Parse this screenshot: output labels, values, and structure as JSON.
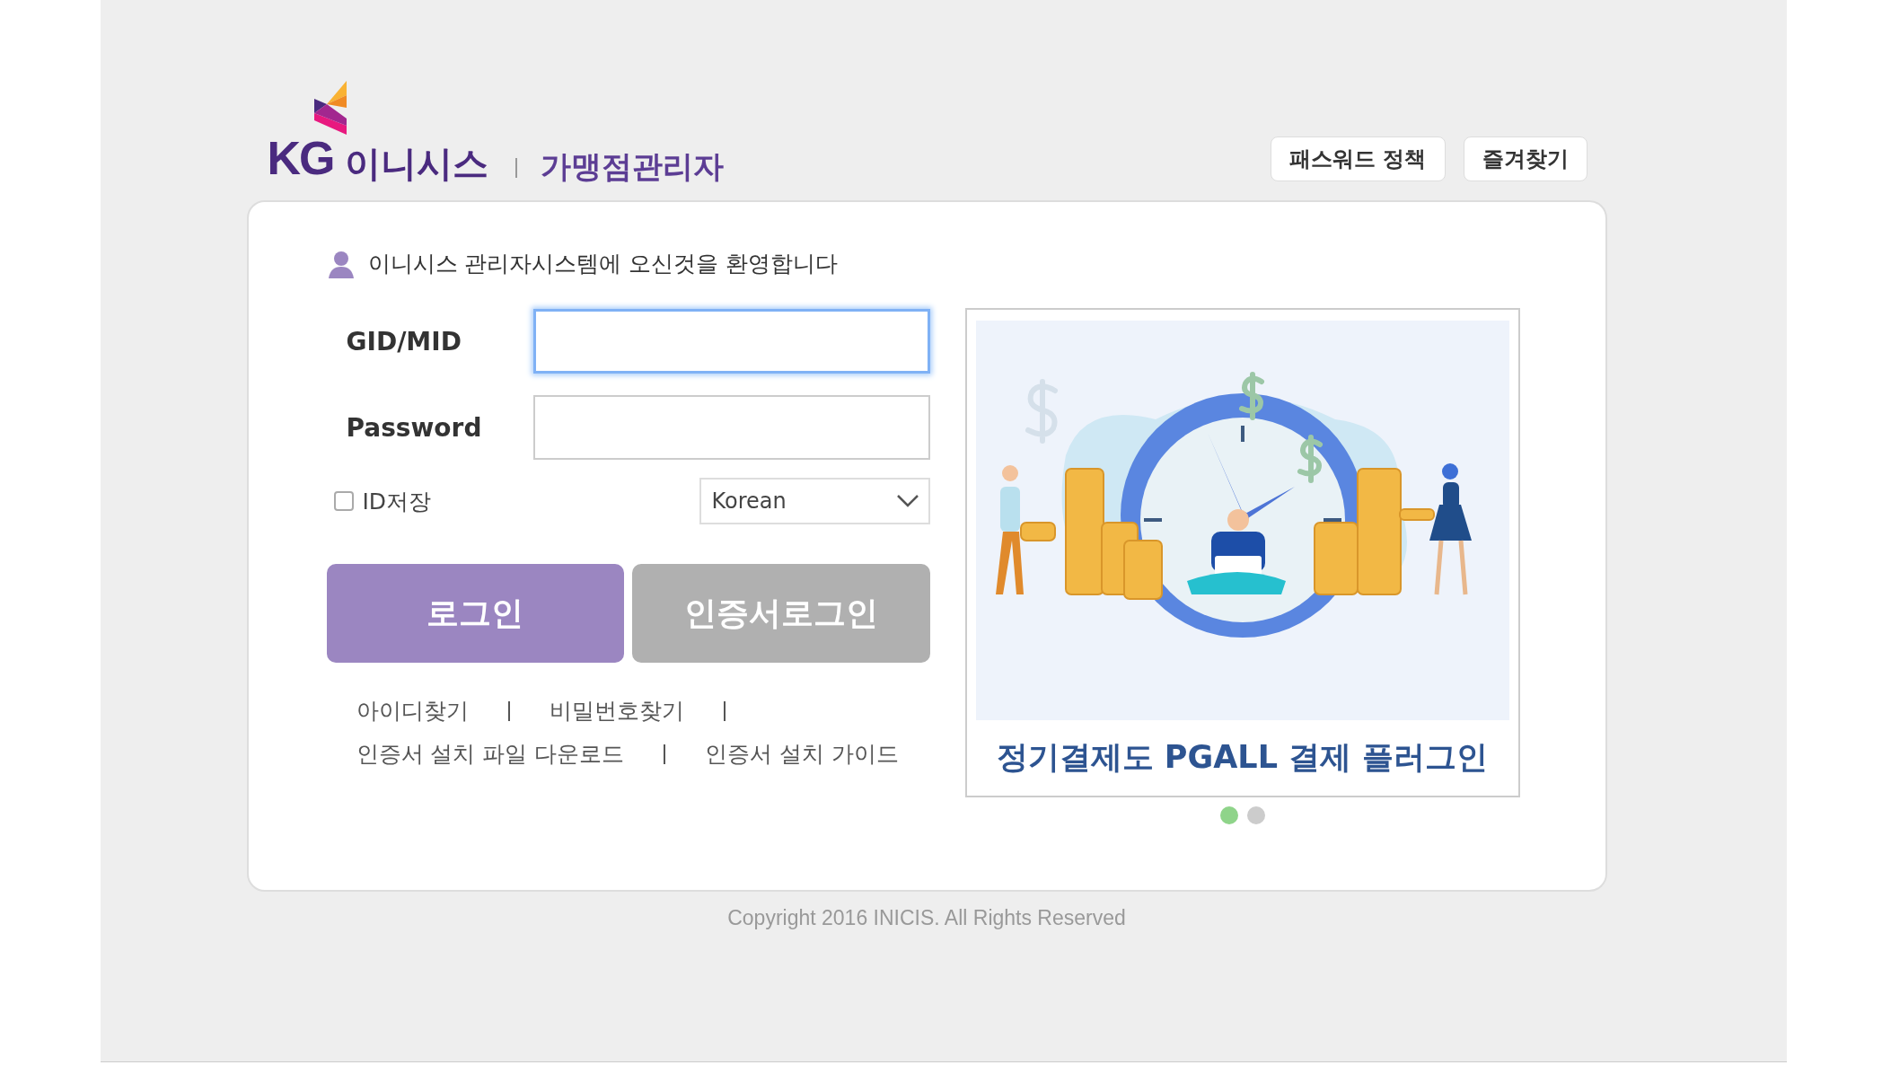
{
  "header": {
    "logo_brand": "KG",
    "logo_name": "이니시스",
    "subtitle": "가맹점관리자",
    "buttons": [
      "패스워드 정책",
      "즐겨찾기"
    ]
  },
  "welcome": "이니시스 관리자시스템에 오신것을 환영합니다",
  "fields": [
    {
      "label": "GID/MID",
      "focused": true
    },
    {
      "label": "Password",
      "focused": false
    }
  ],
  "remember": {
    "label": "ID저장",
    "checked": false
  },
  "language": {
    "value": "Korean"
  },
  "buttons": [
    {
      "label": "로그인",
      "kind": "primary"
    },
    {
      "label": "인증서로그인",
      "kind": "secondary"
    }
  ],
  "links": [
    [
      "아이디찾기",
      "비밀번호찾기"
    ],
    [
      "인증서 설치 파일 다운로드",
      "인증서 설치 가이드"
    ]
  ],
  "banner": {
    "caption": "정기결제도 PGALL 결제 플러그인",
    "dots": [
      {
        "selected": true
      },
      {
        "selected": false
      }
    ]
  },
  "copyright": "Copyright 2016 INICIS. All Rights Reserved"
}
